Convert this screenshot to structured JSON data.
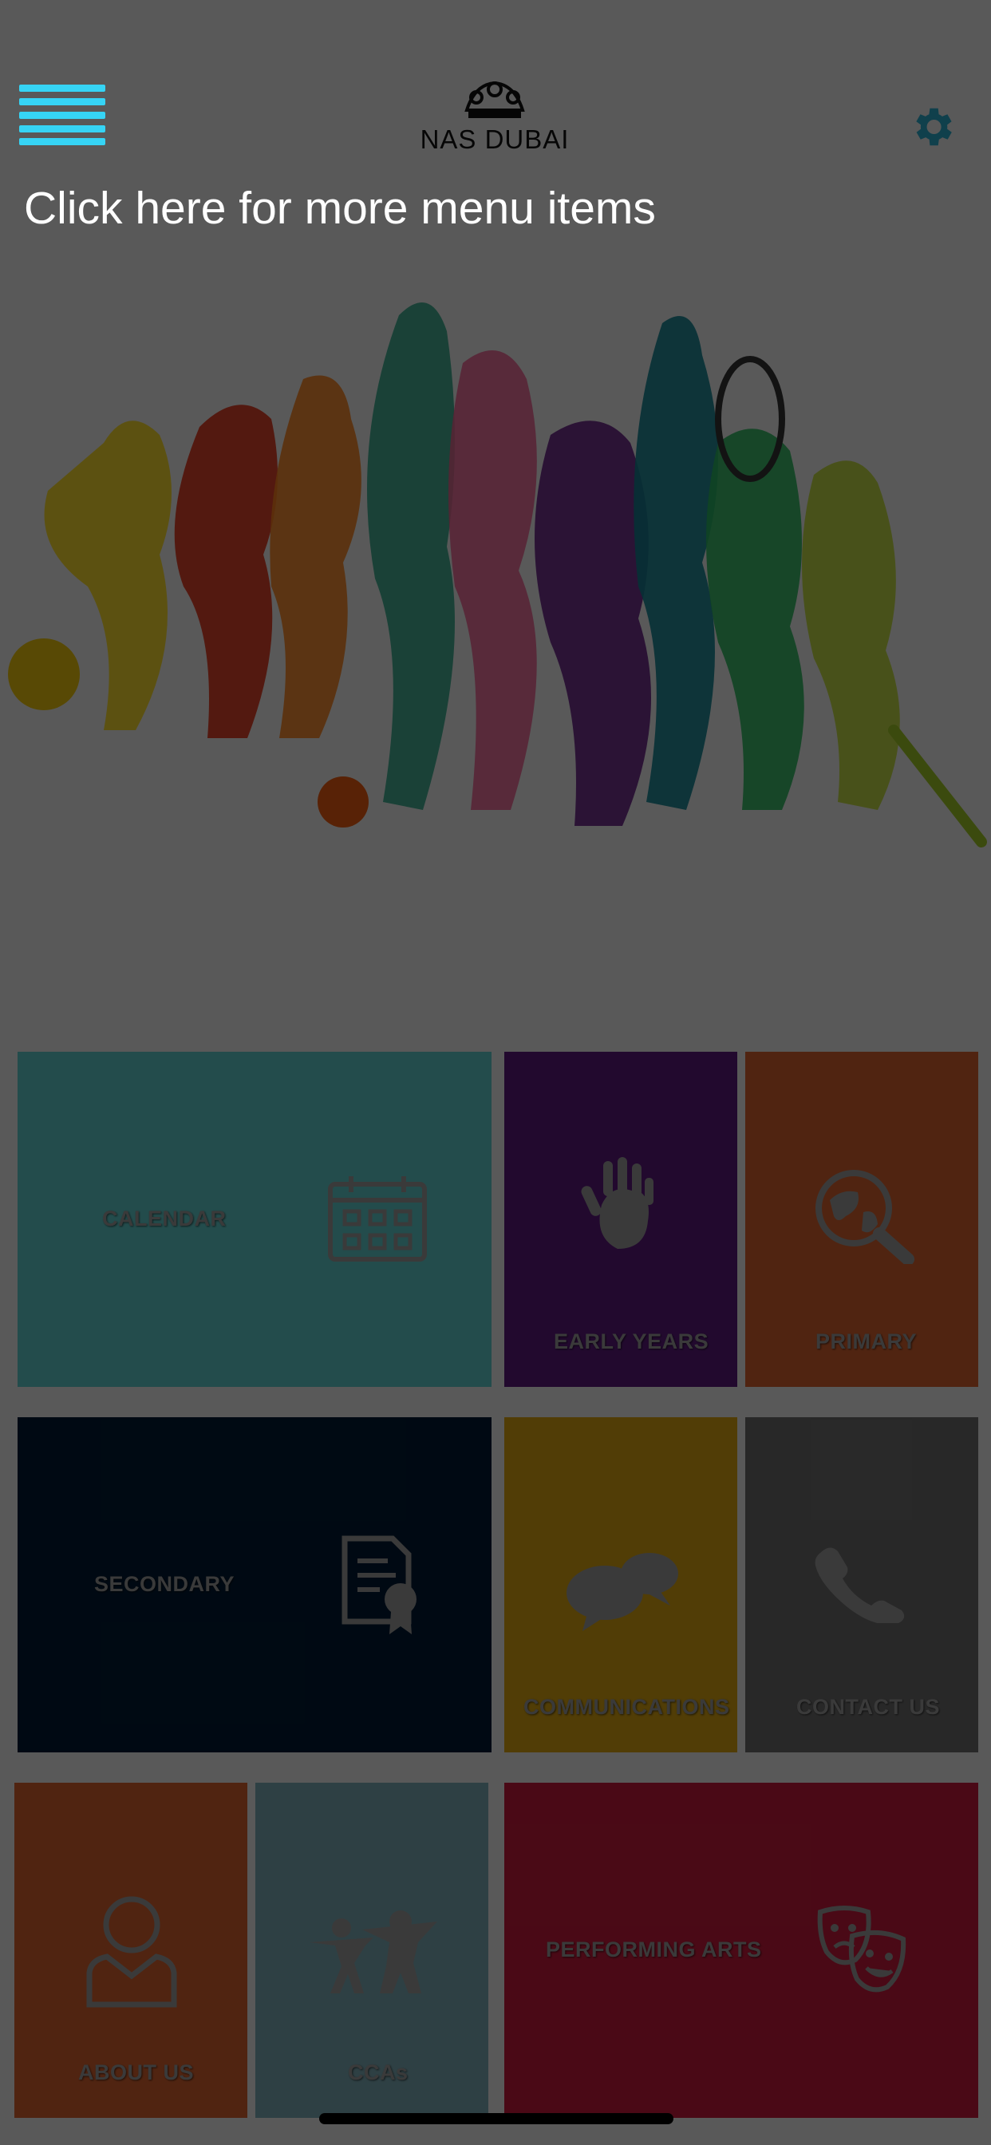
{
  "header": {
    "logo_text": "NAS DUBAI",
    "menu_hint": "Click here for more menu items"
  },
  "colors": {
    "accent": "#36d4f5",
    "gear": "#2aa8c8",
    "calendar": "#5ec8c8",
    "early_years": "#5a1a7a",
    "primary": "#d2602e",
    "secondary": "#001a33",
    "communications": "#d4a011",
    "contact_us": "#6b6b6b",
    "about_us": "#d2602e",
    "ccas": "#7aa8b2",
    "performing_arts": "#c21a3a"
  },
  "tiles": {
    "calendar": "CALENDAR",
    "early_years": "EARLY YEARS",
    "primary": "PRIMARY",
    "secondary": "SECONDARY",
    "communications": "COMMUNICATIONS",
    "contact_us": "CONTACT US",
    "about_us": "ABOUT US",
    "ccas": "CCAs",
    "performing_arts": "PERFORMING ARTS"
  },
  "icons": {
    "menu": "hamburger-icon",
    "settings": "gear-icon",
    "calendar": "calendar-icon",
    "early_years": "handprint-icon",
    "primary": "globe-magnifier-icon",
    "secondary": "certificate-icon",
    "communications": "speech-bubbles-icon",
    "contact_us": "phone-icon",
    "about_us": "person-icon",
    "ccas": "people-icon",
    "performing_arts": "theatre-masks-icon"
  }
}
